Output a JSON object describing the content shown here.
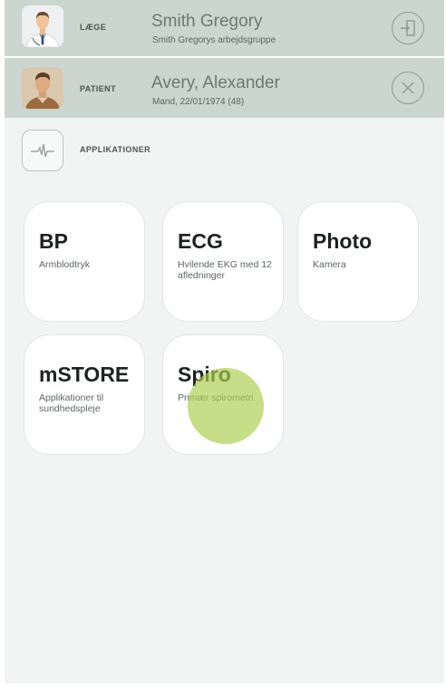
{
  "doctor": {
    "role_label": "LÆGE",
    "name": "Smith Gregory",
    "group": "Smith Gregorys arbejdsgruppe",
    "action_icon": "logout-icon"
  },
  "patient": {
    "role_label": "PATIENT",
    "name": "Avery, Alexander",
    "details": "Mand, 22/01/1974 (48)",
    "action_icon": "close-icon"
  },
  "applications": {
    "header_label": "APPLIKATIONER",
    "header_icon": "heartbeat-icon",
    "tiles": [
      {
        "title": "BP",
        "description": "Armblodtryk"
      },
      {
        "title": "ECG",
        "description": "Hvilende EKG med 12 afledninger"
      },
      {
        "title": "Photo",
        "description": "Kamera"
      },
      {
        "title": "mSTORE",
        "description": "Applikationer til sundhedspleje"
      },
      {
        "title": "Spiro",
        "description": "Primær spirometri"
      }
    ]
  },
  "colors": {
    "header_bar": "#cbd6d0",
    "background": "#f2f4f3",
    "touch_indicator": "#acd050"
  }
}
